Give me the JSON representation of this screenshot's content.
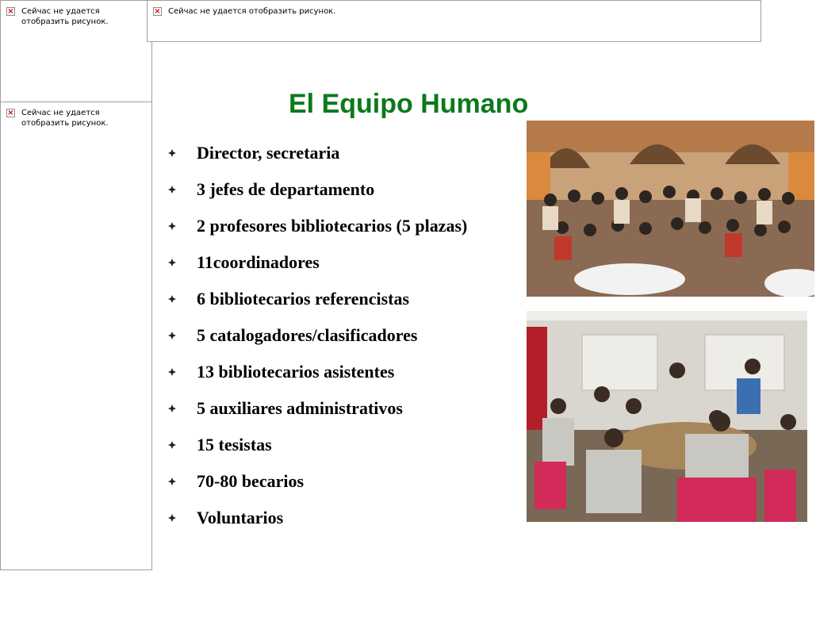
{
  "placeholders": [
    {
      "text": "Сейчас не удается отобразить рисунок."
    },
    {
      "text": "Сейчас не удается отобразить рисунок."
    },
    {
      "text": "Сейчас не удается отобразить рисунок."
    }
  ],
  "slide": {
    "title": "El Equipo Humano",
    "title_color": "#0b7a1c",
    "items": [
      "Director, secretaria",
      "3 jefes de departamento",
      "2 profesores bibliotecarios (5 plazas)",
      "11coordinadores",
      "6 bibliotecarios referencistas",
      "5 catalogadores/clasificadores",
      "13 bibliotecarios asistentes",
      "5 auxiliares administrativos",
      "15 tesistas",
      "70-80 becarios",
      "Voluntarios"
    ]
  },
  "icons": {
    "bullet": "diamond-bullet-icon",
    "broken_image": "broken-image-icon"
  }
}
